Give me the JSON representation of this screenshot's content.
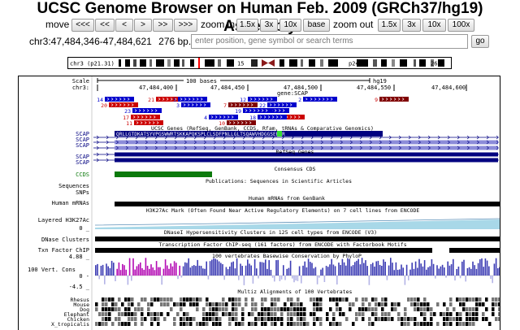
{
  "header": {
    "title": "UCSC Genome Browser on Human Feb. 2009 (GRCh37/hg19) Assembly"
  },
  "nav": {
    "move_label": "move",
    "move_buttons": [
      "<<<",
      "<<",
      "<",
      ">",
      ">>",
      ">>>"
    ],
    "zoom_in_label": "zoom in",
    "zoom_in_buttons": [
      "1.5x",
      "3x",
      "10x",
      "base"
    ],
    "zoom_out_label": "zoom out",
    "zoom_out_buttons": [
      "1.5x",
      "3x",
      "10x",
      "100x"
    ]
  },
  "position": {
    "value": "chr3:47,484,346-47,484,621",
    "size": "276 bp.",
    "search_placeholder": "enter position, gene symbol or search terms",
    "go_label": "go"
  },
  "ideogram": {
    "chrom_label": "chr3 (p21.31)",
    "band_labels": [
      "15",
      "p24",
      "26"
    ]
  },
  "ruler": {
    "scale_label": "Scale",
    "chrom_label": "chr3:",
    "scale_bar": "100 bases",
    "assembly": "hg19",
    "ticks": [
      "47,484,400",
      "47,484,450",
      "47,484,500",
      "47,484,550",
      "47,484,600"
    ],
    "gene_label": "gene:SCAP"
  },
  "tracks": {
    "exon_numbers": [
      "14",
      "20",
      "21",
      "5",
      "3",
      "23",
      "7",
      "17",
      "8",
      "11",
      "4",
      "19",
      "10",
      "12",
      "22",
      "2",
      "16",
      "6",
      "9",
      "18"
    ],
    "ucsc_genes_title": "UCSC Genes (RefSeq, GenBank, CCDS, Rfam, tRNAs & Comparative Genomics)",
    "refseq_title": "RefSeq Genes",
    "consensus_title": "Consensus CDS",
    "publications_title": "Publications: Sequences in Scientific Articles",
    "mrna_title": "Human mRNAs from GenBank",
    "h3k27ac_title": "H3K27Ac Mark (Often Found Near Active Regulatory Elements) on 7 cell lines from ENCODE",
    "dnase_title": "DNaseI Hypersensitivity Clusters in 125 cell types from ENCODE (V3)",
    "tfbs_title": "Transcription Factor ChIP-seq (161 factors) from ENCODE with Factorbook Motifs",
    "cons_title": "100 vertebrates Basewise Conservation by PhyloP",
    "multiz_title": "Multiz Alignments of 100 Vertebrates",
    "protein_seq": "QRLLGTDKATSYVPGSWWRTSKKAPQKSPLCLSDFPNLLGLTSQAWVHDGGSERWR"
  },
  "left_labels": {
    "scap1": "SCAP",
    "scap2": "SCAP",
    "scap3": "SCAP",
    "scap4": "SCAP",
    "scap5": "SCAP",
    "ccds": "CCDS",
    "sequences": "Sequences",
    "snps": "SNPs",
    "human_mrnas": "Human mRNAs",
    "layered": "Layered H3K27Ac",
    "h3_zero": "0 _",
    "dnase": "DNase Clusters",
    "txn": "Txn Factor ChIP",
    "cons_max": "4.88 _",
    "cons_name": "100 Vert. Cons",
    "cons_zero": "0 -",
    "cons_min": "-4.5 _",
    "species": [
      "Rhesus",
      "Mouse",
      "Dog",
      "Elephant",
      "Chicken",
      "X_tropicalis"
    ]
  },
  "colors": {
    "gene_dark": "#000080",
    "gene_light": "#8c8cd9",
    "exon_blue": "#0000cc",
    "exon_red": "#cc0000",
    "exon_darkred": "#800000",
    "ccds_green": "#0c7a0c",
    "cons_blue": "#3c3cb4",
    "cons_purple": "#b40ab4",
    "cursor_red": "#ff0000",
    "border_gray": "#999999"
  }
}
